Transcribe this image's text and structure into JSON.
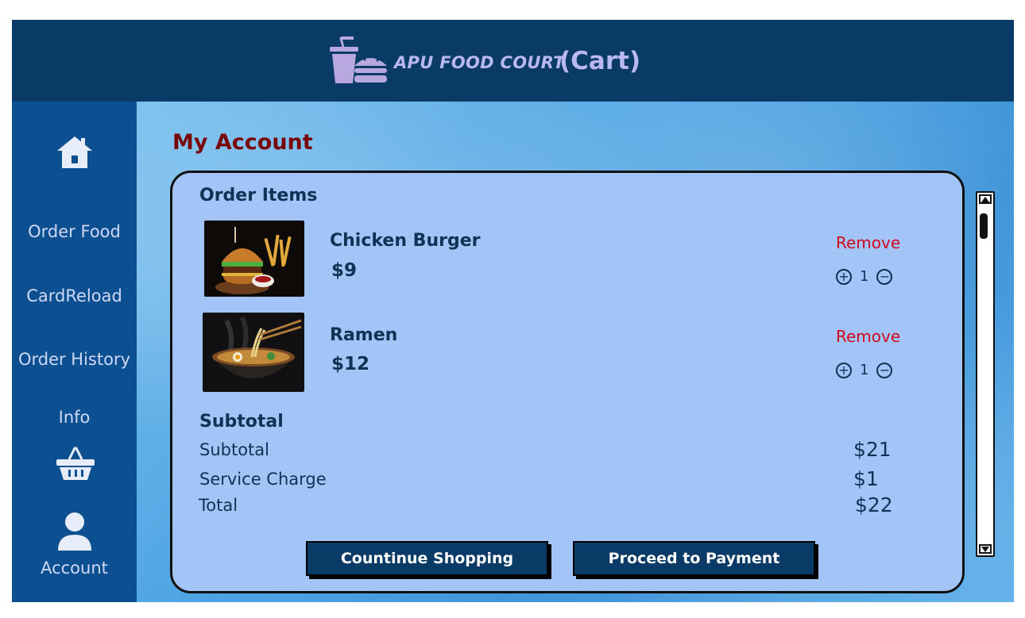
{
  "header": {
    "brand": "APU FOOD COURT",
    "page_label": "(Cart)",
    "logo_icon": "food-court-logo-icon"
  },
  "sidebar": {
    "home_icon": "home-icon",
    "items": [
      {
        "label": "Order Food"
      },
      {
        "label": "CardReload"
      },
      {
        "label": "Order History"
      },
      {
        "label": "Info"
      }
    ],
    "basket_icon": "basket-icon",
    "account": {
      "label": "Account",
      "icon": "user-icon"
    }
  },
  "main": {
    "title": "My Account",
    "order_items_title": "Order Items",
    "items": [
      {
        "name": "Chicken Burger",
        "price": "$9",
        "remove_label": "Remove",
        "qty": "1",
        "plus": "+",
        "minus": "−"
      },
      {
        "name": "Ramen",
        "price": "$12",
        "remove_label": "Remove",
        "qty": "1",
        "plus": "+",
        "minus": "−"
      }
    ],
    "subtotal_title": "Subtotal",
    "summary": [
      {
        "label": "Subtotal",
        "value": "$21"
      },
      {
        "label": "Service Charge",
        "value": "$1"
      },
      {
        "label": "Total",
        "value": "$22"
      }
    ],
    "buttons": {
      "continue": "Countinue Shopping",
      "payment": "Proceed to Payment"
    }
  },
  "colors": {
    "header_bg": "#0a3a66",
    "sidebar_bg": "#0d5091",
    "panel_bg": "#a2c4f6",
    "title_red": "#7a0707",
    "remove_red": "#d0081c",
    "brand_lavender": "#b9b8f0"
  }
}
